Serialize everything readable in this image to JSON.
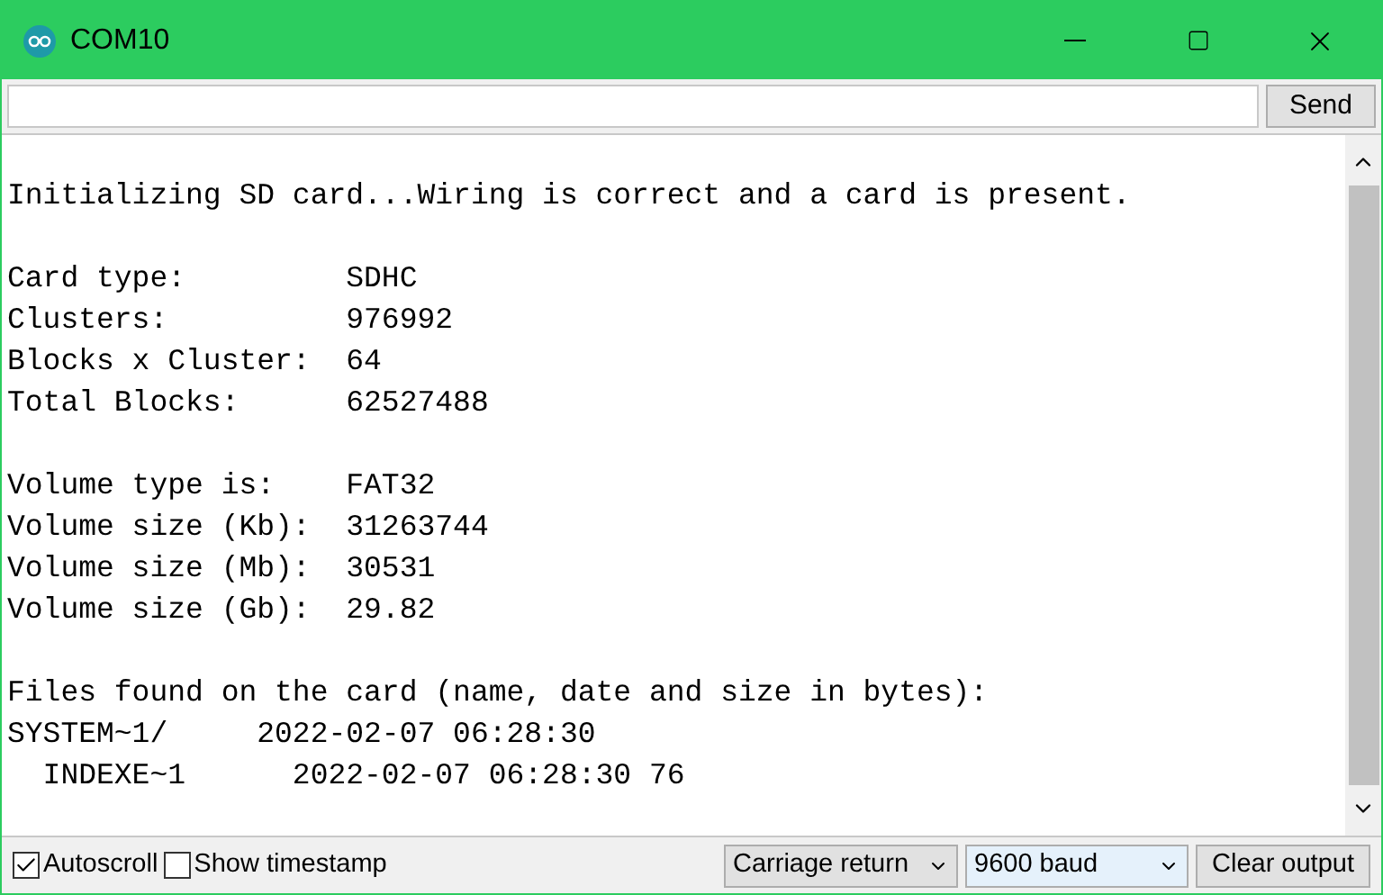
{
  "window": {
    "title": "COM10"
  },
  "send_bar": {
    "button": "Send"
  },
  "output": {
    "blocks": [
      [
        "Initializing SD card...Wiring is correct and a card is present."
      ],
      [
        "Card type:         SDHC",
        "Clusters:          976992",
        "Blocks x Cluster:  64",
        "Total Blocks:      62527488"
      ],
      [
        "Volume type is:    FAT32",
        "Volume size (Kb):  31263744",
        "Volume size (Mb):  30531",
        "Volume size (Gb):  29.82"
      ],
      [
        "Files found on the card (name, date and size in bytes):",
        "SYSTEM~1/     2022-02-07 06:28:30",
        "  INDEXE~1      2022-02-07 06:28:30 76"
      ]
    ]
  },
  "status_bar": {
    "checkboxes": [
      {
        "label": "Autoscroll",
        "checked": true
      },
      {
        "label": "Show timestamp",
        "checked": false
      }
    ],
    "line_ending": "Carriage return",
    "baud": "9600 baud",
    "clear_button": "Clear output"
  }
}
